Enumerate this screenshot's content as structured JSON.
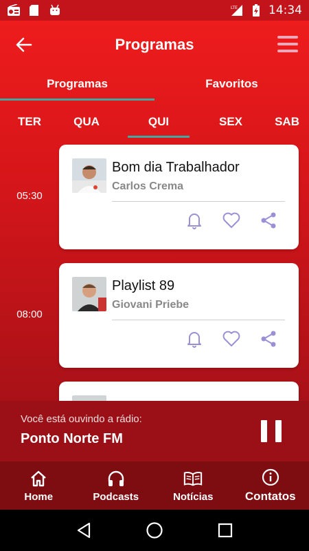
{
  "status_bar": {
    "time": "14:34",
    "network": "LTE"
  },
  "header": {
    "title": "Programas"
  },
  "tabs": [
    {
      "label": "Programas",
      "active": true
    },
    {
      "label": "Favoritos",
      "active": false
    }
  ],
  "days": [
    {
      "label": "TER",
      "active": false
    },
    {
      "label": "QUA",
      "active": false
    },
    {
      "label": "QUI",
      "active": true
    },
    {
      "label": "SEX",
      "active": false
    },
    {
      "label": "SAB",
      "active": false
    }
  ],
  "programs": [
    {
      "time": "05:30",
      "title": "Bom dia Trabalhador",
      "host": "Carlos Crema"
    },
    {
      "time": "08:00",
      "title": "Playlist 89",
      "host": "Giovani Priebe"
    }
  ],
  "now_playing": {
    "label": "Você está ouvindo a rádio:",
    "station": "Ponto Norte FM"
  },
  "bottom_nav": [
    {
      "label": "Home",
      "icon": "home-icon"
    },
    {
      "label": "Podcasts",
      "icon": "headphones-icon"
    },
    {
      "label": "Notícias",
      "icon": "book-icon"
    },
    {
      "label": "Contatos",
      "icon": "info-icon"
    }
  ],
  "colors": {
    "primary": "#ee1c1c",
    "dark": "#7e0d12",
    "accent": "#3fa9a5",
    "icon_purple": "#9b8fd6"
  }
}
